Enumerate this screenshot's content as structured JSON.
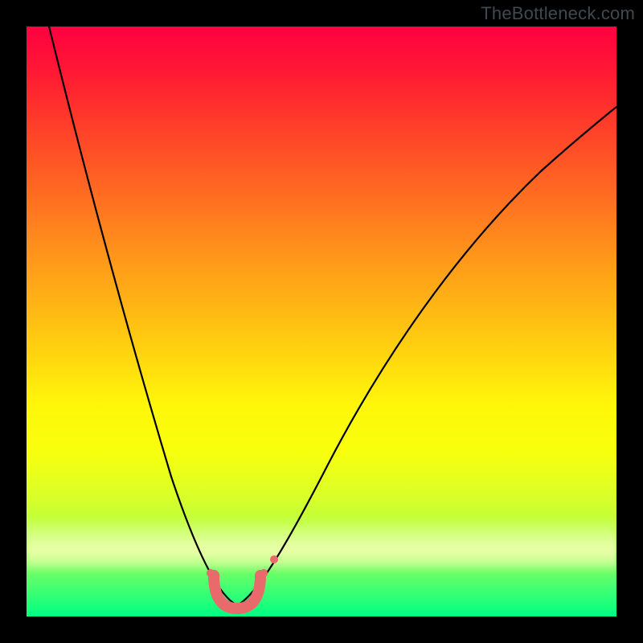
{
  "watermark": "TheBottleneck.com",
  "chart_data": {
    "type": "line",
    "title": "",
    "xlabel": "",
    "ylabel": "",
    "xlim": [
      0,
      100
    ],
    "ylim": [
      0,
      100
    ],
    "series": [
      {
        "name": "bottleneck-curve",
        "x": [
          4,
          8,
          12,
          16,
          20,
          24,
          27,
          30,
          33,
          35,
          37,
          39,
          42,
          46,
          50,
          55,
          60,
          66,
          72,
          78,
          85,
          92,
          99
        ],
        "values": [
          100,
          82,
          66,
          52,
          40,
          29,
          20,
          12,
          6,
          2,
          0,
          2,
          6,
          12,
          20,
          29,
          38,
          47,
          55,
          63,
          71,
          79,
          86
        ]
      }
    ],
    "annotations": {
      "minimum_marker_x": 36,
      "minimum_marker_shape": "U",
      "marker_color": "#e86a6a"
    },
    "background_gradient": {
      "top": "#ff0040",
      "middle": "#ffd60f",
      "bottom": "#00ff82"
    }
  }
}
